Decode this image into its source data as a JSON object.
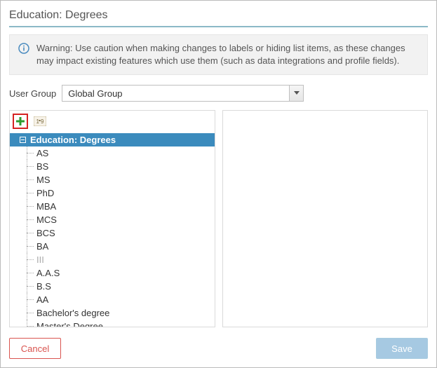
{
  "title": "Education: Degrees",
  "warning": {
    "text": "Warning: Use caution when making changes to labels or hiding list items, as these changes may impact existing features which use them (such as data integrations and profile fields)."
  },
  "user_group": {
    "label": "User Group",
    "selected": "Global Group"
  },
  "tree": {
    "root_label": "Education: Degrees",
    "items": [
      {
        "label": "AS",
        "disabled": false
      },
      {
        "label": "BS",
        "disabled": false
      },
      {
        "label": "MS",
        "disabled": false
      },
      {
        "label": "PhD",
        "disabled": false
      },
      {
        "label": "MBA",
        "disabled": false
      },
      {
        "label": "MCS",
        "disabled": false
      },
      {
        "label": "BCS",
        "disabled": false
      },
      {
        "label": "BA",
        "disabled": false
      },
      {
        "label": "III",
        "disabled": true
      },
      {
        "label": "A.A.S",
        "disabled": false
      },
      {
        "label": "B.S",
        "disabled": false
      },
      {
        "label": "AA",
        "disabled": false
      },
      {
        "label": "Bachelor's degree",
        "disabled": false
      },
      {
        "label": "Master's Degree",
        "disabled": false
      }
    ]
  },
  "buttons": {
    "cancel": "Cancel",
    "save": "Save"
  }
}
